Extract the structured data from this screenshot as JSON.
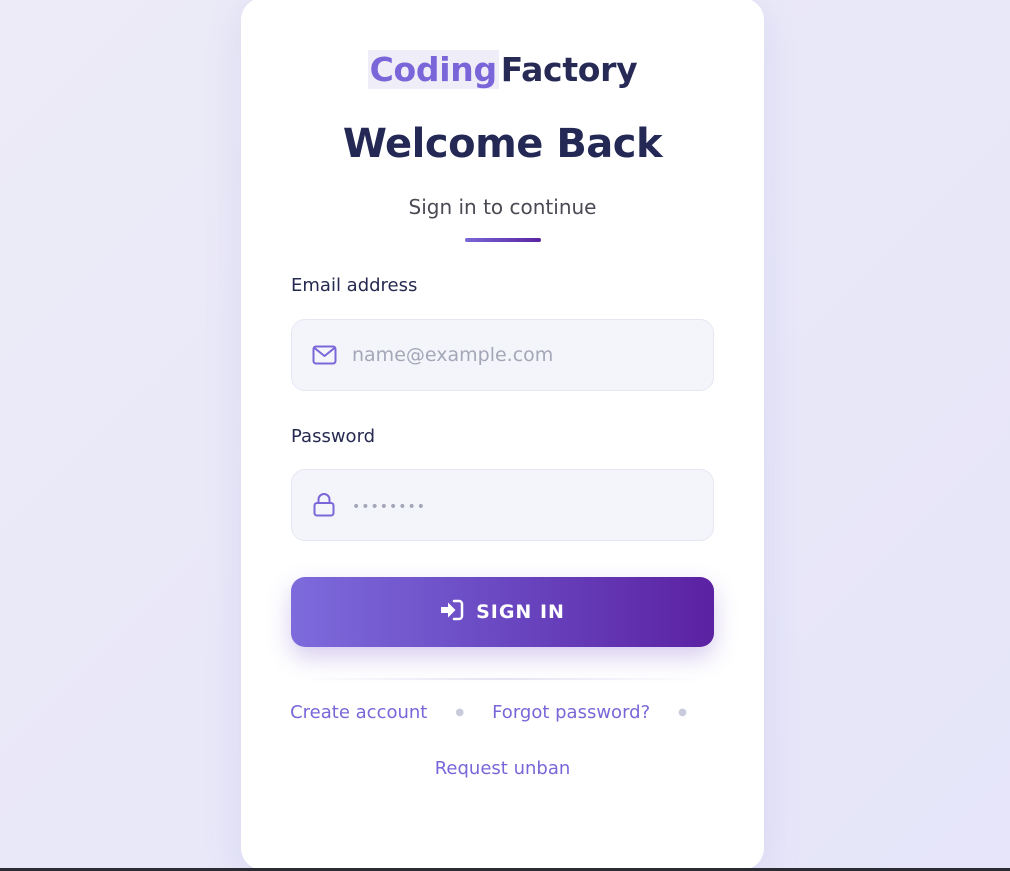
{
  "brand": {
    "highlight": "Coding",
    "rest": "Factory"
  },
  "heading": {
    "title": "Welcome Back",
    "subtitle": "Sign in to continue"
  },
  "form": {
    "email": {
      "label": "Email address",
      "placeholder": "name@example.com",
      "icon": "mail-icon"
    },
    "password": {
      "label": "Password",
      "placeholder": "••••••••",
      "icon": "lock-icon"
    },
    "submit": {
      "label": "SIGN IN",
      "icon": "sign-in-icon"
    }
  },
  "links": {
    "create_account": "Create account",
    "forgot_password": "Forgot password?",
    "request_unban": "Request unban"
  },
  "colors": {
    "accent": "#7a66d8",
    "accent_dark": "#5b21a2",
    "heading": "#232855",
    "field_bg": "#f4f5fb"
  }
}
